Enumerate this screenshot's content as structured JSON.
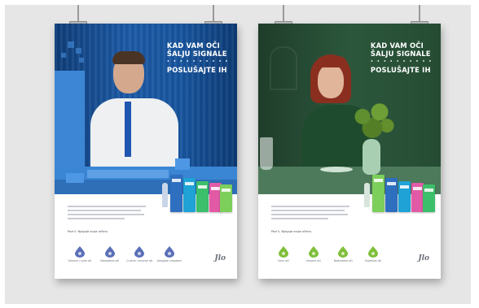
{
  "posters": [
    {
      "theme": "blue",
      "headline_line1": "KAD VAM OČI",
      "headline_line2": "ŠALJU SIGNALE",
      "dots": "• • • • • • • • • •",
      "headline_line3": "POSLUŠAJTE IH",
      "tagline": "Pazi li. Njeguje svoje očima.",
      "icon_color": "#5a6fb8",
      "icons": [
        {
          "icon": "droplet-icon",
          "caption": "Umorne i suhe oči"
        },
        {
          "icon": "droplet-icon",
          "caption": "Nadražene oči"
        },
        {
          "icon": "droplet-icon",
          "caption": "Crvene i umorne oči"
        },
        {
          "icon": "droplet-icon",
          "caption": "Alergijski simptomi"
        }
      ],
      "brand": "Jlo"
    },
    {
      "theme": "green",
      "headline_line1": "KAD VAM OČI",
      "headline_line2": "ŠALJU SIGNALE",
      "dots": "• • • • • • • • • •",
      "headline_line3": "POSLUŠAJTE IH",
      "tagline": "Pazi li. Njeguje svoje očima.",
      "icon_color": "#7fbf3a",
      "icons": [
        {
          "icon": "droplet-icon",
          "caption": "Suhe oči"
        },
        {
          "icon": "droplet-icon",
          "caption": "Umorne oči"
        },
        {
          "icon": "droplet-icon",
          "caption": "Nadražene oči"
        },
        {
          "icon": "droplet-icon",
          "caption": "Osjetljive oči"
        }
      ],
      "brand": "Jlo"
    }
  ],
  "colors": {
    "wall": "#e6e6e6",
    "poster1_scene": "#17549d",
    "poster2_scene": "#2c573c",
    "product_colors": [
      "#2f6fc0",
      "#1fa2d6",
      "#3bbf6a",
      "#e25aa6",
      "#7dcf5c"
    ]
  }
}
